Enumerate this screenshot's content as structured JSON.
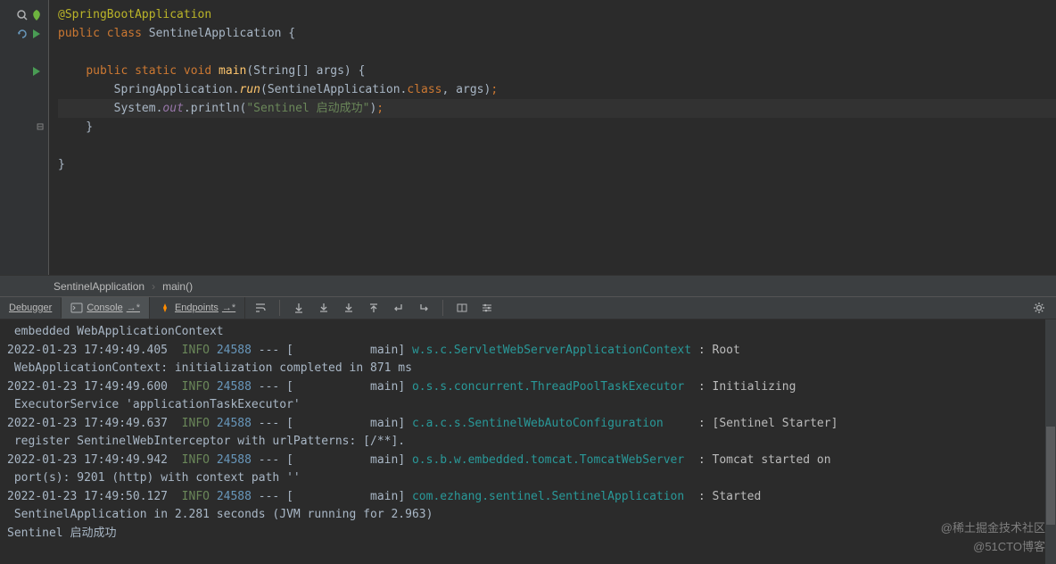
{
  "code": {
    "annotation": "@SpringBootApplication",
    "pub": "public",
    "cls": "class",
    "className": "SentinelApplication",
    "openBrace": " {",
    "static": "static",
    "void": "void",
    "main": "main",
    "params": "(String[] args) {",
    "runLine1": "SpringApplication.",
    "run": "run",
    "runArgs": "(SentinelApplication.",
    "classKw": "class",
    "runArgsEnd": ", args)",
    "semi": ";",
    "sys": "System.",
    "out": "out",
    "println": ".println(",
    "str": "\"Sentinel 启动成功\"",
    "printlnEnd": ")",
    "closeBrace1": "    }",
    "closeBrace2": "}"
  },
  "breadcrumb": {
    "item1": "SentinelApplication",
    "item2": "main()"
  },
  "toolwindow": {
    "debugger": "Debugger",
    "console": "Console",
    "endpoints": "Endpoints"
  },
  "console": {
    "line1": " embedded WebApplicationContext",
    "log1": {
      "time": "2022-01-23 17:49:49.405",
      "level": "INFO",
      "pid": "24588",
      "thread": "--- [           main] ",
      "class": "w.s.c.ServletWebServerApplicationContext",
      "pad": " ",
      "msg": ": Root"
    },
    "line2": " WebApplicationContext: initialization completed in 871 ms",
    "log2": {
      "time": "2022-01-23 17:49:49.600",
      "level": "INFO",
      "pid": "24588",
      "thread": "--- [           main] ",
      "class": "o.s.s.concurrent.ThreadPoolTaskExecutor",
      "pad": "  ",
      "msg": ": Initializing"
    },
    "line3": " ExecutorService 'applicationTaskExecutor'",
    "log3": {
      "time": "2022-01-23 17:49:49.637",
      "level": "INFO",
      "pid": "24588",
      "thread": "--- [           main] ",
      "class": "c.a.c.s.SentinelWebAutoConfiguration",
      "pad": "     ",
      "msg": ": [Sentinel Starter]"
    },
    "line4": " register SentinelWebInterceptor with urlPatterns: [/**].",
    "log4": {
      "time": "2022-01-23 17:49:49.942",
      "level": "INFO",
      "pid": "24588",
      "thread": "--- [           main] ",
      "class": "o.s.b.w.embedded.tomcat.TomcatWebServer",
      "pad": "  ",
      "msg": ": Tomcat started on"
    },
    "line5": " port(s): 9201 (http) with context path ''",
    "log5": {
      "time": "2022-01-23 17:49:50.127",
      "level": "INFO",
      "pid": "24588",
      "thread": "--- [           main] ",
      "class": "com.ezhang.sentinel.SentinelApplication",
      "pad": "  ",
      "msg": ": Started"
    },
    "line6": " SentinelApplication in 2.281 seconds (JVM running for 2.963)",
    "finalLine": "Sentinel 启动成功"
  },
  "watermark": {
    "line1": "@稀土掘金技术社区",
    "line2": "@51CTO博客"
  }
}
